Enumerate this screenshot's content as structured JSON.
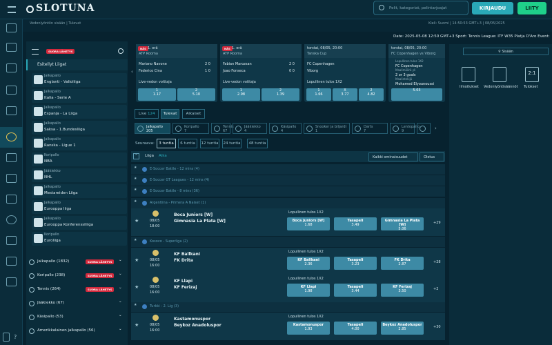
{
  "header": {
    "logo": "SLOTUNA",
    "search_placeholder": "Pelit, kategoriat, pelintarjoajat",
    "login": "KIRJAUDU",
    "join": "LIITY"
  },
  "subbar": {
    "breadcrumb": "Vedonlyöntiin sisään  |  Tulevat",
    "right": "Kieli: Suomi   |   14:50:53 GMT+3   |   08/05/2025"
  },
  "ticker": "Date: 2025-05-08 12:50 GMT+3 Sport: Tennis League: ITF W35 Platja D'Aro Event: Corin",
  "left": {
    "live_badge": "SUORA LÄHETYS",
    "featured_title": "Esitellyt Liigat",
    "featured": [
      {
        "sport": "Jalkapallo",
        "league": "Englanti - Valioliiga"
      },
      {
        "sport": "Jalkapallo",
        "league": "Italia - Serie A"
      },
      {
        "sport": "Jalkapallo",
        "league": "Espanja - La Liiga"
      },
      {
        "sport": "Jalkapallo",
        "league": "Saksa - 1.Bundesliiga"
      },
      {
        "sport": "Jalkapallo",
        "league": "Ranska - Ligue 1"
      },
      {
        "sport": "Koripallo",
        "league": "NBA"
      },
      {
        "sport": "Jääkiekko",
        "league": "NHL"
      },
      {
        "sport": "Jalkapallo",
        "league": "Mestareiden Liiga"
      },
      {
        "sport": "Jalkapallo",
        "league": "Eurooppa liiga"
      },
      {
        "sport": "Jalkapallo",
        "league": "Eurooppa Konferenssiliiga"
      },
      {
        "sport": "Koripallo",
        "league": "Euroliiga"
      }
    ],
    "sports": [
      {
        "name": "Jalkapallo",
        "count": "(1832)",
        "live": true
      },
      {
        "name": "Koripallo",
        "count": "(238)",
        "live": true
      },
      {
        "name": "Tennis",
        "count": "(264)",
        "live": true
      },
      {
        "name": "Jääkiekko",
        "count": "(67)",
        "live": false
      },
      {
        "name": "Käsipallo",
        "count": "(53)",
        "live": false
      },
      {
        "name": "Amerikkalainen jalkapallo",
        "count": "(56)",
        "live": false
      }
    ]
  },
  "cards": [
    {
      "tag": "NÄS",
      "time": "1. erä",
      "league": "ATP Rooma",
      "p1": "Mariano Navone",
      "s1": "2  0",
      "p2": "Federico Cina",
      "s2": "1  0",
      "market": "Live-vedon voittaja",
      "o1l": "1",
      "o1": "1.17",
      "o2l": "2",
      "o2": "5.10"
    },
    {
      "tag": "NÄS",
      "time": "1. erä",
      "league": "ATP Rooma",
      "p1": "Fabian Marozsan",
      "s1": "2  0",
      "p2": "Joao Fonseca",
      "s2": "0  0",
      "market": "Live-vedon voittaja",
      "o1l": "1",
      "o1": "2.98",
      "o2l": "2",
      "o2": "1.39"
    },
    {
      "tag": "",
      "time": "torstai, 08/05, 20:00",
      "league": "Tanska Cup",
      "p1": "FC Copenhagen",
      "s1": "",
      "p2": "Viborg",
      "s2": "",
      "market": "Lopullinen tulos 1X2",
      "o1l": "1",
      "o1": "1.66",
      "oxl": "X",
      "ox": "3.77",
      "o2l": "2",
      "o2": "4.82"
    },
    {
      "tag": "",
      "time": "torstai, 08/05, 20:00",
      "league": "FC Copenhagen vs Viborg",
      "lines": [
        "Lopullinen tulos 1X2",
        "FC Copenhagen",
        "Maalimäärä yli",
        "2 or 3 goals",
        "Maalintekijä",
        "Mohamed Elyounoussi"
      ],
      "o1": "5.03"
    }
  ],
  "tabs": {
    "live": "Live",
    "live_count": "124",
    "upcoming": "Tulevat",
    "outrights": "Aikaiset"
  },
  "sport_chips": [
    {
      "name": "Jalkapallo",
      "count": "205"
    },
    {
      "name": "Koripallo",
      "count": "7"
    },
    {
      "name": "Tennis",
      "count": "67"
    },
    {
      "name": "Jääkiekko",
      "count": "4"
    },
    {
      "name": "Käsipallo",
      "count": "4"
    },
    {
      "name": "Snooker ja biljardi",
      "count": "1"
    },
    {
      "name": "Darts",
      "count": "7"
    },
    {
      "name": "Lentopallo",
      "count": "9"
    },
    {
      "name": "",
      "count": ""
    }
  ],
  "next": {
    "label": "Seuraava:",
    "options": [
      "3 tuntia",
      "6 tuntia",
      "12 tuntia",
      "24 tuntia",
      "48 tuntia"
    ]
  },
  "sort": {
    "liiga": "Liiga",
    "aika": "Aika",
    "filter": "Kaikki ominaisuudet",
    "odds": "Oletus"
  },
  "sections": [
    {
      "name": "E-Soccer Battle - 12 mins (4)"
    },
    {
      "name": "E-Soccer GT Leagues - 12 mins (4)"
    },
    {
      "name": "E-Soccer Battle - 8 mins (36)"
    },
    {
      "name": "Argentiina - Primera A Naiset (1)"
    },
    {
      "name": "Kosovo - Superliga (2)"
    },
    {
      "name": "Turkki - 2. Lig (3)"
    }
  ],
  "matches": [
    {
      "date": "08/05",
      "time": "18:00",
      "home": "Boca Juniors [W]",
      "away": "Gimnasia La Plata [W]",
      "market": "Lopullinen tulos 1X2",
      "l1": "Boca Juniors [W]",
      "o1": "1.68",
      "lx": "Tasapeli",
      "ox": "3.49",
      "l2": "Gimnasia La Plata [W]",
      "o2": "5.06",
      "more": "+29"
    },
    {
      "date": "08/05",
      "time": "16:00",
      "home": "KF Ballkani",
      "away": "FK Drita",
      "market": "Lopullinen tulos 1X2",
      "l1": "KF Ballkani",
      "o1": "2.36",
      "lx": "Tasapeli",
      "ox": "3.23",
      "l2": "FK Drita",
      "o2": "2.87",
      "more": "+28"
    },
    {
      "date": "08/05",
      "time": "16:00",
      "home": "KF Llapi",
      "away": "KF Ferizaj",
      "market": "Lopullinen tulos 1X2",
      "l1": "KF Llapi",
      "o1": "1.98",
      "lx": "Tasapeli",
      "ox": "3.44",
      "l2": "KF Ferizaj",
      "o2": "3.50",
      "more": "+2"
    },
    {
      "date": "08/05",
      "time": "16:00",
      "home": "Kastamonuspor",
      "away": "Beykoz Anadoluspor",
      "market": "Lopullinen tulos 1X2",
      "l1": "Kastamonuspor",
      "o1": "1.93",
      "lx": "Tasapeli",
      "ox": "4.00",
      "l2": "Beykoz Anadoluspor",
      "o2": "2.85",
      "more": "+30"
    }
  ],
  "right": {
    "login": "Sisään",
    "links": [
      "Ilmoitukset",
      "Vedonlyöntisäännöt",
      "Tulokset"
    ],
    "ratio": "2:1"
  }
}
